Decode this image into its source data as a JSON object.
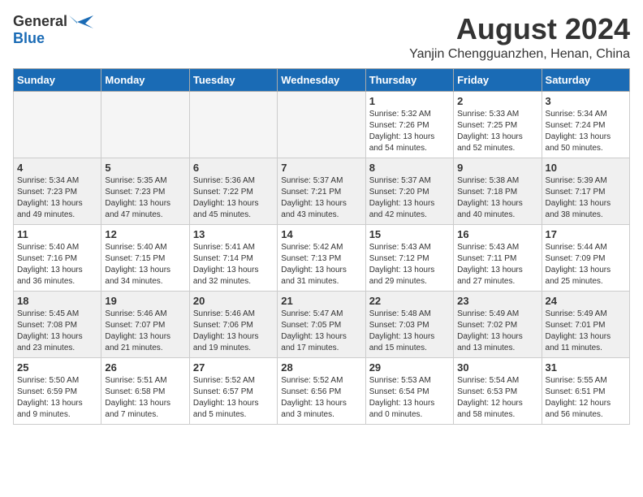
{
  "header": {
    "logo_general": "General",
    "logo_blue": "Blue",
    "month_year": "August 2024",
    "location": "Yanjin Chengguanzhen, Henan, China"
  },
  "days_of_week": [
    "Sunday",
    "Monday",
    "Tuesday",
    "Wednesday",
    "Thursday",
    "Friday",
    "Saturday"
  ],
  "weeks": [
    [
      {
        "day": "",
        "info": "",
        "empty": true
      },
      {
        "day": "",
        "info": "",
        "empty": true
      },
      {
        "day": "",
        "info": "",
        "empty": true
      },
      {
        "day": "",
        "info": "",
        "empty": true
      },
      {
        "day": "1",
        "info": "Sunrise: 5:32 AM\nSunset: 7:26 PM\nDaylight: 13 hours\nand 54 minutes."
      },
      {
        "day": "2",
        "info": "Sunrise: 5:33 AM\nSunset: 7:25 PM\nDaylight: 13 hours\nand 52 minutes."
      },
      {
        "day": "3",
        "info": "Sunrise: 5:34 AM\nSunset: 7:24 PM\nDaylight: 13 hours\nand 50 minutes."
      }
    ],
    [
      {
        "day": "4",
        "info": "Sunrise: 5:34 AM\nSunset: 7:23 PM\nDaylight: 13 hours\nand 49 minutes."
      },
      {
        "day": "5",
        "info": "Sunrise: 5:35 AM\nSunset: 7:23 PM\nDaylight: 13 hours\nand 47 minutes."
      },
      {
        "day": "6",
        "info": "Sunrise: 5:36 AM\nSunset: 7:22 PM\nDaylight: 13 hours\nand 45 minutes."
      },
      {
        "day": "7",
        "info": "Sunrise: 5:37 AM\nSunset: 7:21 PM\nDaylight: 13 hours\nand 43 minutes."
      },
      {
        "day": "8",
        "info": "Sunrise: 5:37 AM\nSunset: 7:20 PM\nDaylight: 13 hours\nand 42 minutes."
      },
      {
        "day": "9",
        "info": "Sunrise: 5:38 AM\nSunset: 7:18 PM\nDaylight: 13 hours\nand 40 minutes."
      },
      {
        "day": "10",
        "info": "Sunrise: 5:39 AM\nSunset: 7:17 PM\nDaylight: 13 hours\nand 38 minutes."
      }
    ],
    [
      {
        "day": "11",
        "info": "Sunrise: 5:40 AM\nSunset: 7:16 PM\nDaylight: 13 hours\nand 36 minutes."
      },
      {
        "day": "12",
        "info": "Sunrise: 5:40 AM\nSunset: 7:15 PM\nDaylight: 13 hours\nand 34 minutes."
      },
      {
        "day": "13",
        "info": "Sunrise: 5:41 AM\nSunset: 7:14 PM\nDaylight: 13 hours\nand 32 minutes."
      },
      {
        "day": "14",
        "info": "Sunrise: 5:42 AM\nSunset: 7:13 PM\nDaylight: 13 hours\nand 31 minutes."
      },
      {
        "day": "15",
        "info": "Sunrise: 5:43 AM\nSunset: 7:12 PM\nDaylight: 13 hours\nand 29 minutes."
      },
      {
        "day": "16",
        "info": "Sunrise: 5:43 AM\nSunset: 7:11 PM\nDaylight: 13 hours\nand 27 minutes."
      },
      {
        "day": "17",
        "info": "Sunrise: 5:44 AM\nSunset: 7:09 PM\nDaylight: 13 hours\nand 25 minutes."
      }
    ],
    [
      {
        "day": "18",
        "info": "Sunrise: 5:45 AM\nSunset: 7:08 PM\nDaylight: 13 hours\nand 23 minutes."
      },
      {
        "day": "19",
        "info": "Sunrise: 5:46 AM\nSunset: 7:07 PM\nDaylight: 13 hours\nand 21 minutes."
      },
      {
        "day": "20",
        "info": "Sunrise: 5:46 AM\nSunset: 7:06 PM\nDaylight: 13 hours\nand 19 minutes."
      },
      {
        "day": "21",
        "info": "Sunrise: 5:47 AM\nSunset: 7:05 PM\nDaylight: 13 hours\nand 17 minutes."
      },
      {
        "day": "22",
        "info": "Sunrise: 5:48 AM\nSunset: 7:03 PM\nDaylight: 13 hours\nand 15 minutes."
      },
      {
        "day": "23",
        "info": "Sunrise: 5:49 AM\nSunset: 7:02 PM\nDaylight: 13 hours\nand 13 minutes."
      },
      {
        "day": "24",
        "info": "Sunrise: 5:49 AM\nSunset: 7:01 PM\nDaylight: 13 hours\nand 11 minutes."
      }
    ],
    [
      {
        "day": "25",
        "info": "Sunrise: 5:50 AM\nSunset: 6:59 PM\nDaylight: 13 hours\nand 9 minutes."
      },
      {
        "day": "26",
        "info": "Sunrise: 5:51 AM\nSunset: 6:58 PM\nDaylight: 13 hours\nand 7 minutes."
      },
      {
        "day": "27",
        "info": "Sunrise: 5:52 AM\nSunset: 6:57 PM\nDaylight: 13 hours\nand 5 minutes."
      },
      {
        "day": "28",
        "info": "Sunrise: 5:52 AM\nSunset: 6:56 PM\nDaylight: 13 hours\nand 3 minutes."
      },
      {
        "day": "29",
        "info": "Sunrise: 5:53 AM\nSunset: 6:54 PM\nDaylight: 13 hours\nand 0 minutes."
      },
      {
        "day": "30",
        "info": "Sunrise: 5:54 AM\nSunset: 6:53 PM\nDaylight: 12 hours\nand 58 minutes."
      },
      {
        "day": "31",
        "info": "Sunrise: 5:55 AM\nSunset: 6:51 PM\nDaylight: 12 hours\nand 56 minutes."
      }
    ]
  ]
}
